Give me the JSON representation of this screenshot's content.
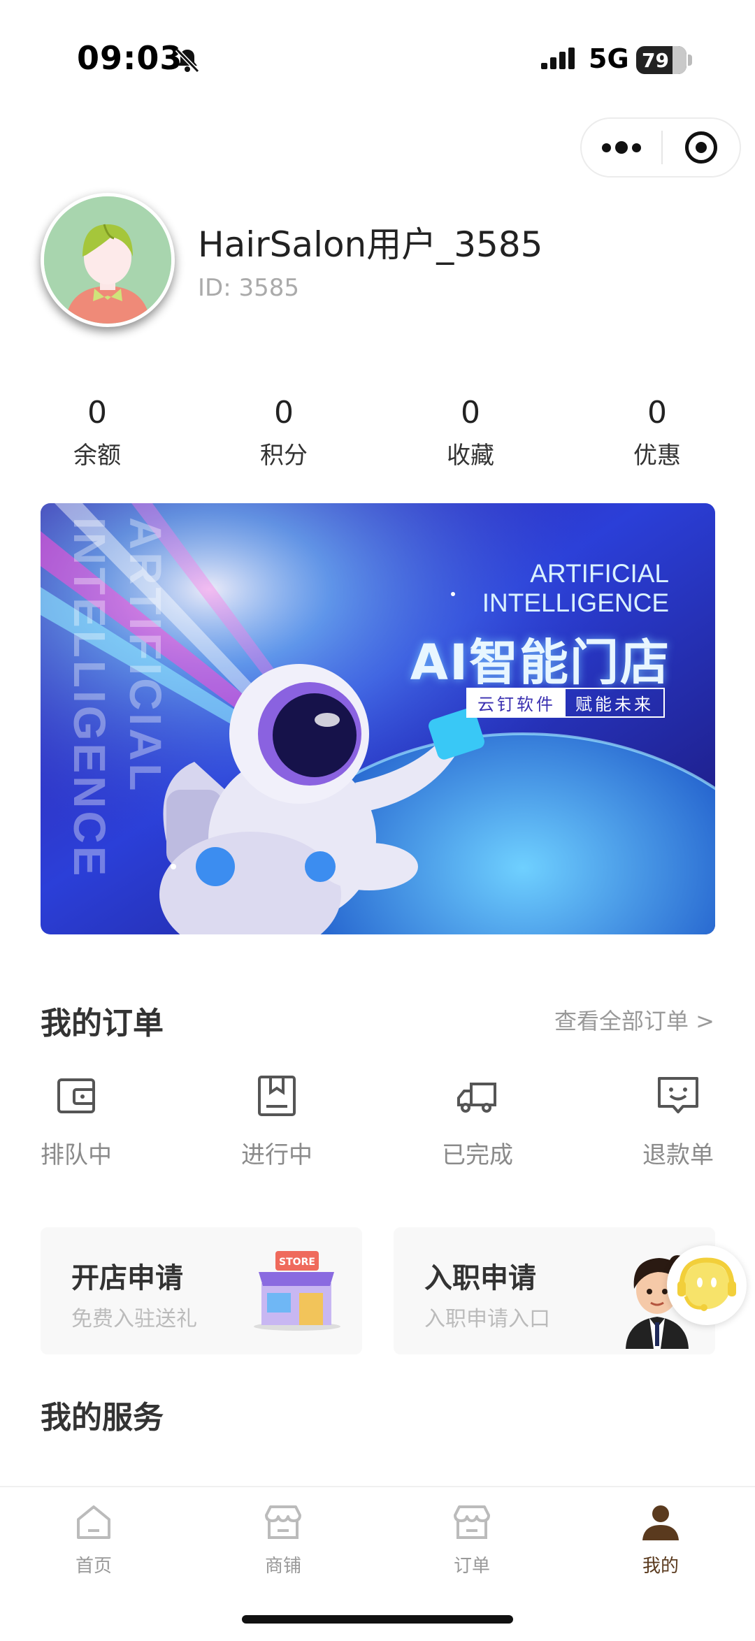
{
  "status_bar": {
    "time": "09:03",
    "network": "5G",
    "battery": "79"
  },
  "profile": {
    "username": "HairSalon用户_3585",
    "user_id": "ID: 3585"
  },
  "stats": [
    {
      "value": "0",
      "label": "余额"
    },
    {
      "value": "0",
      "label": "积分"
    },
    {
      "value": "0",
      "label": "收藏"
    },
    {
      "value": "0",
      "label": "优惠"
    }
  ],
  "banner": {
    "line1": "ARTIFICIAL",
    "line2": "INTELLIGENCE",
    "title": "AI智能门店",
    "tag1": "云钉软件",
    "tag2": "赋能未来",
    "vertical_text": "ARTIFICIAL INTELLIGENCE"
  },
  "orders": {
    "title": "我的订单",
    "view_all": "查看全部订单 >",
    "items": [
      {
        "label": "排队中",
        "icon": "wallet-icon"
      },
      {
        "label": "进行中",
        "icon": "bookmark-box-icon"
      },
      {
        "label": "已完成",
        "icon": "truck-icon"
      },
      {
        "label": "退款单",
        "icon": "smile-message-icon"
      }
    ]
  },
  "cards": [
    {
      "title": "开店申请",
      "subtitle": "免费入驻送礼",
      "store_sign": "STORE"
    },
    {
      "title": "入职申请",
      "subtitle": "入职申请入口"
    }
  ],
  "services": {
    "title": "我的服务"
  },
  "tabbar": [
    {
      "label": "首页",
      "icon": "home-icon"
    },
    {
      "label": "商铺",
      "icon": "shop-icon"
    },
    {
      "label": "订单",
      "icon": "order-icon"
    },
    {
      "label": "我的",
      "icon": "person-icon",
      "active": true
    }
  ],
  "colors": {
    "active_tab": "#5a3a1e",
    "inactive": "#999999",
    "card_bg": "#f8f8f8"
  }
}
